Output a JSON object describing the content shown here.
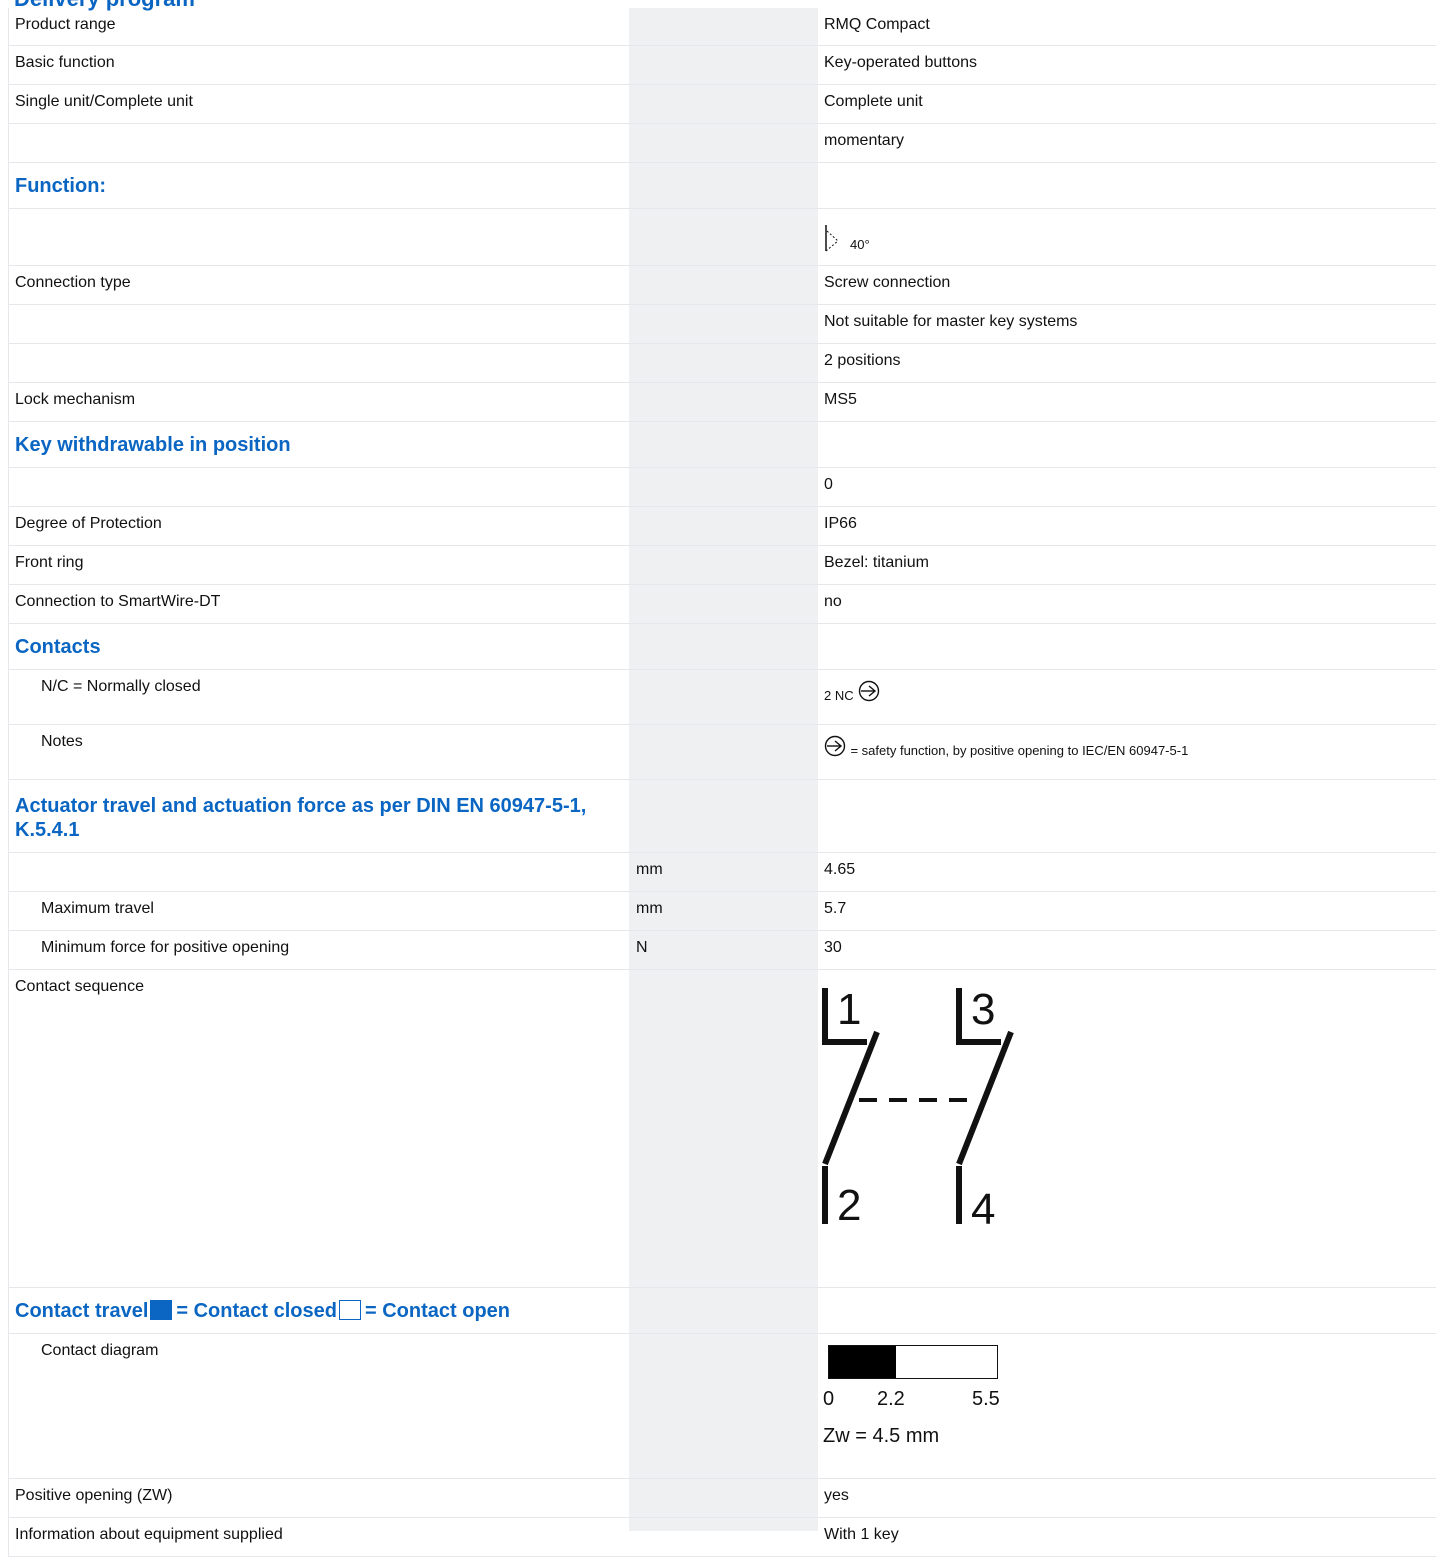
{
  "header": {
    "cut_title": "Delivery program"
  },
  "rows": {
    "product_range": {
      "label": "Product range",
      "value": "RMQ Compact"
    },
    "basic_function": {
      "label": "Basic function",
      "value": "Key-operated buttons"
    },
    "unit": {
      "label": "Single unit/Complete unit",
      "value": "Complete unit"
    },
    "momentary": {
      "value": "momentary"
    },
    "function_heading": {
      "label": "Function:"
    },
    "angle": {
      "value": "40°"
    },
    "connection_type": {
      "label": "Connection type",
      "value": "Screw connection"
    },
    "master_key": {
      "value": "Not suitable for master key systems"
    },
    "positions": {
      "value": "2 positions"
    },
    "lock_mechanism": {
      "label": "Lock mechanism",
      "value": "MS5"
    },
    "key_withdrawable_heading": {
      "label": "Key withdrawable in position"
    },
    "key_position": {
      "value": "0"
    },
    "degree_protection": {
      "label": "Degree of Protection",
      "value": "IP66"
    },
    "front_ring": {
      "label": "Front ring",
      "value": "Bezel: titanium"
    },
    "smartwire": {
      "label": "Connection to SmartWire-DT",
      "value": "no"
    },
    "contacts_heading": {
      "label": "Contacts"
    },
    "nc": {
      "label": "N/C = Normally closed",
      "value": "2 NC"
    },
    "notes": {
      "label": "Notes",
      "value": "= safety function, by positive opening to IEC/EN 60947-5-1"
    },
    "actuator_heading": {
      "label_line1": "Actuator travel and actuation force as per DIN EN 60947-5-1,",
      "label_line2": "K.5.4.1"
    },
    "travel": {
      "unit": "mm",
      "value": "4.65"
    },
    "max_travel": {
      "label": "Maximum travel",
      "unit": "mm",
      "value": "5.7"
    },
    "min_force": {
      "label": "Minimum force for positive opening",
      "unit": "N",
      "value": "30"
    },
    "contact_sequence": {
      "label": "Contact sequence",
      "terminals": [
        "1",
        "2",
        "3",
        "4"
      ]
    },
    "contact_travel_heading": {
      "part1": "Contact travel",
      "part2": "= Contact closed",
      "part3": "= Contact open"
    },
    "contact_diagram": {
      "label": "Contact diagram",
      "ticks": [
        "0",
        "2.2",
        "5.5"
      ],
      "zw_text": "Zw = 4.5 mm",
      "closed_until": 2.2,
      "total": 5.5
    },
    "positive_opening": {
      "label": "Positive opening (ZW)",
      "value": "yes"
    },
    "equipment": {
      "label": "Information about equipment supplied",
      "value": "With 1 key"
    }
  },
  "colors": {
    "accent": "#0a66c2",
    "shade": "#eef0f2",
    "divider": "#e5e7ea"
  }
}
